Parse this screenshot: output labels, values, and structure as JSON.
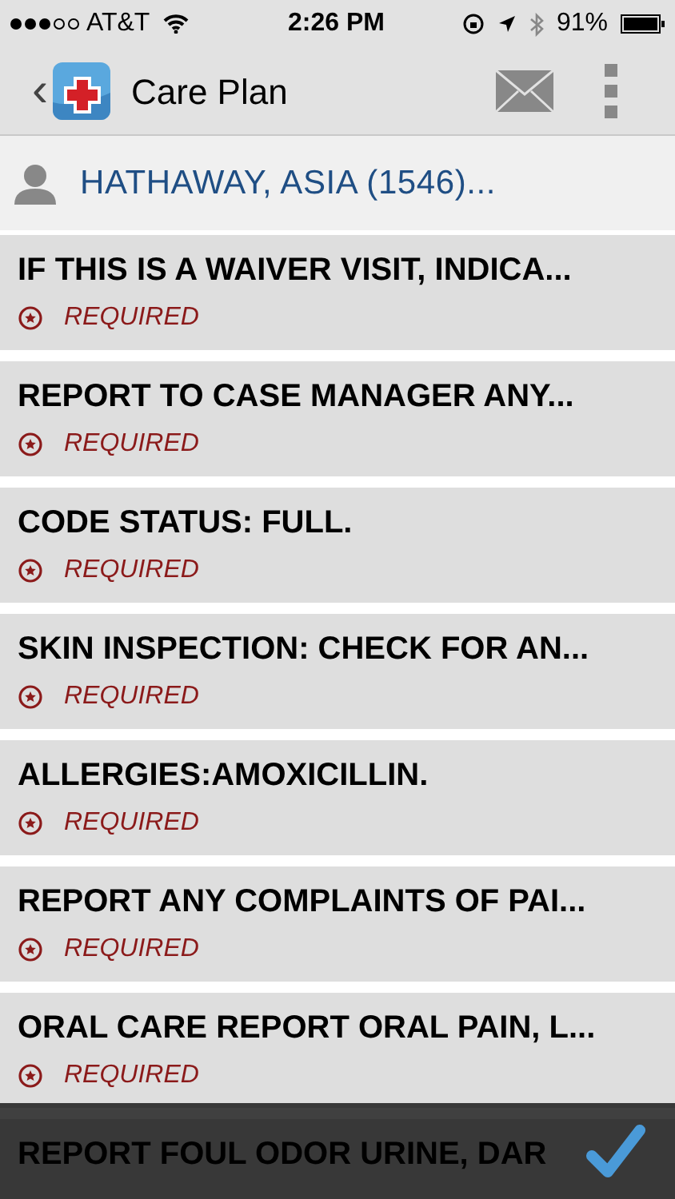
{
  "status_bar": {
    "carrier": "AT&T",
    "time": "2:26 PM",
    "battery": "91%"
  },
  "nav_bar": {
    "back": "‹",
    "title": "Care Plan"
  },
  "patient": {
    "name": "HATHAWAY, ASIA (1546)..."
  },
  "items": [
    {
      "title": "IF THIS IS A WAIVER VISIT, INDICA...",
      "badge": "REQUIRED"
    },
    {
      "title": "REPORT TO CASE MANAGER ANY...",
      "badge": "REQUIRED"
    },
    {
      "title": "CODE STATUS: FULL.",
      "badge": "REQUIRED"
    },
    {
      "title": "SKIN INSPECTION: CHECK FOR AN...",
      "badge": "REQUIRED"
    },
    {
      "title": "ALLERGIES:AMOXICILLIN.",
      "badge": "REQUIRED"
    },
    {
      "title": "REPORT ANY COMPLAINTS OF PAI...",
      "badge": "REQUIRED"
    },
    {
      "title": "ORAL CARE REPORT ORAL PAIN, L...",
      "badge": "REQUIRED"
    },
    {
      "title": "REPORT FOUL ODOR URINE, DAR"
    }
  ]
}
